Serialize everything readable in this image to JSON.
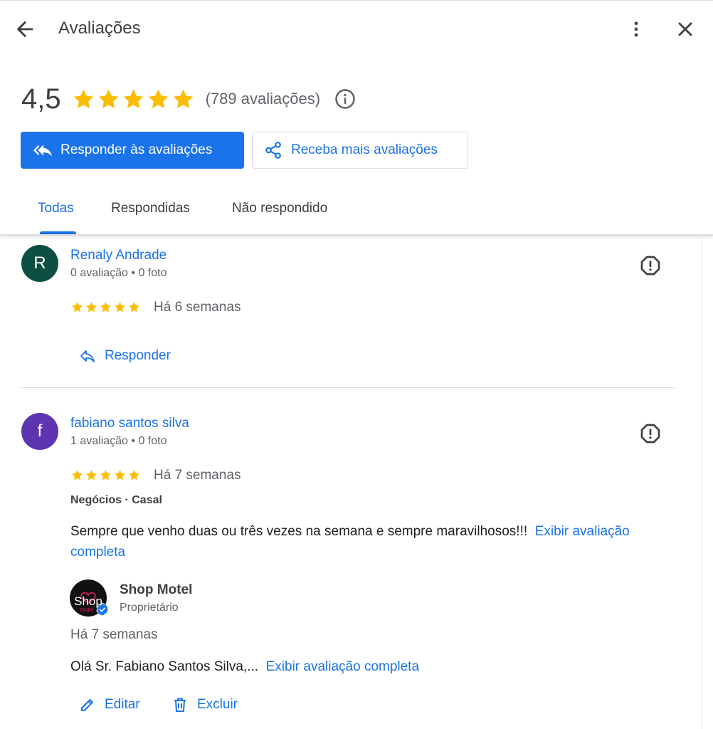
{
  "header": {
    "title": "Avaliações",
    "back_icon": "arrow-back-icon",
    "more_icon": "more-vert-icon",
    "close_icon": "close-icon"
  },
  "summary": {
    "score": "4,5",
    "stars": 5,
    "count_text": "(789 avaliações)",
    "info_icon": "info-icon"
  },
  "buttons": {
    "reply_all": "Responder às avaliações",
    "get_more": "Receba mais avaliações"
  },
  "tabs": [
    {
      "label": "Todas",
      "active": true
    },
    {
      "label": "Respondidas",
      "active": false
    },
    {
      "label": "Não respondido",
      "active": false
    }
  ],
  "colors": {
    "accent": "#1a73e8",
    "star": "#fbbc04",
    "avatar_r": "#0d5041",
    "avatar_f": "#5e35b1"
  },
  "reviews": [
    {
      "avatar_letter": "R",
      "author": "Renaly Andrade",
      "meta": "0 avaliação • 0 foto",
      "rating": 5,
      "when": "Há 6 semanas",
      "reply_action": "Responder"
    },
    {
      "avatar_letter": "f",
      "author": "fabiano santos silva",
      "meta": "1 avaliação • 0 foto",
      "rating": 5,
      "when": "Há 7 semanas",
      "tags": "Negócios · Casal",
      "text": "Sempre que venho duas ou três vezes na semana e sempre maravilhosos!!!",
      "more_link": "Exibir avaliação completa",
      "owner": {
        "name": "Shop Motel",
        "role": "Proprietário",
        "logo_text": "Shop",
        "logo_subtext": "motel",
        "when": "Há 7 semanas",
        "text": "Olá Sr. Fabiano Santos Silva,...",
        "more_link": "Exibir avaliação completa"
      },
      "edit_action": "Editar",
      "delete_action": "Excluir"
    }
  ]
}
